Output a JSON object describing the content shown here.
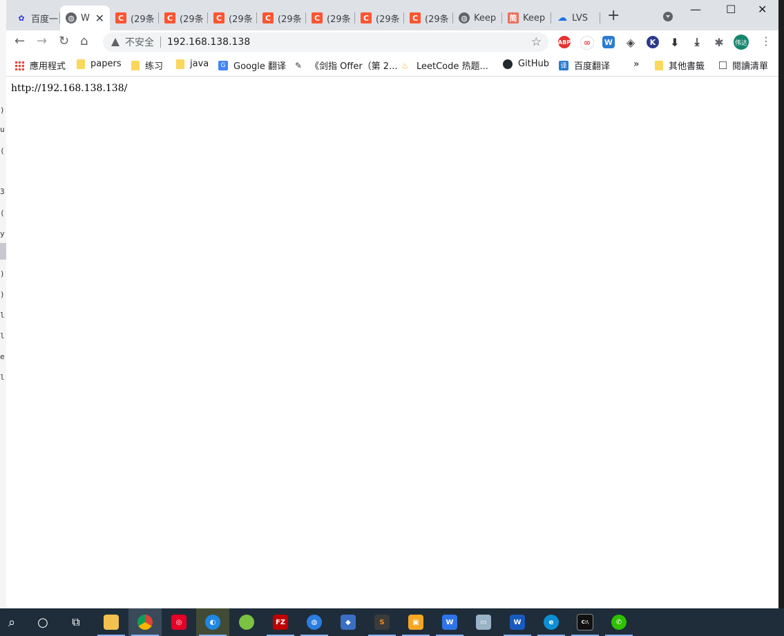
{
  "background_left": {
    "lines": [
      ")",
      "u",
      "(",
      "3",
      "(",
      "y",
      "-",
      ")",
      ")",
      "l",
      "l",
      "e",
      "l"
    ]
  },
  "tabs": [
    {
      "title": "百度一",
      "icon": "baidu-paw-icon",
      "color": "#2932e1"
    },
    {
      "title": "W",
      "icon": "globe-icon",
      "color": "#5f6368",
      "active": true
    },
    {
      "title": "(29条",
      "icon": "csdn-c-icon",
      "color": "#fc5531"
    },
    {
      "title": "(29条",
      "icon": "csdn-c-icon",
      "color": "#fc5531"
    },
    {
      "title": "(29条",
      "icon": "csdn-c-icon",
      "color": "#fc5531"
    },
    {
      "title": "(29条",
      "icon": "csdn-c-icon",
      "color": "#fc5531"
    },
    {
      "title": "(29条",
      "icon": "csdn-c-icon",
      "color": "#fc5531"
    },
    {
      "title": "(29条",
      "icon": "csdn-c-icon",
      "color": "#fc5531"
    },
    {
      "title": "(29条",
      "icon": "csdn-c-icon",
      "color": "#fc5531"
    },
    {
      "title": "Keep",
      "icon": "globe-icon",
      "color": "#5f6368"
    },
    {
      "title": "Keep",
      "icon": "jianshu-icon",
      "color": "#ea6f5a"
    },
    {
      "title": "LVS",
      "icon": "cloud-icon",
      "color": "#1a73e8"
    }
  ],
  "new_tab_label": "+",
  "window_controls": {
    "minimize": "—",
    "maximize": "☐",
    "close": "✕"
  },
  "toolbar": {
    "security_label": "不安全",
    "url": "192.168.138.138",
    "extensions": [
      {
        "name": "adblock-plus-icon",
        "label": "ABP",
        "color": "#e8312f"
      },
      {
        "name": "chain-extension-icon",
        "label": "∞",
        "color": "#e04c4c"
      },
      {
        "name": "word-extension-icon",
        "label": "W",
        "color": "#2b7cd3"
      },
      {
        "name": "shield-extension-icon",
        "label": "◈",
        "color": "#444444"
      },
      {
        "name": "k-extension-icon",
        "label": "K",
        "color": "#2d3a8c"
      },
      {
        "name": "download-extension-icon",
        "label": "⬇",
        "color": "#333333"
      },
      {
        "name": "downloads-icon",
        "label": "⤓",
        "color": "#333333"
      },
      {
        "name": "puzzle-extensions-icon",
        "label": "✱",
        "color": "#5f6368"
      }
    ],
    "avatar_text": "伟达"
  },
  "bookmarks": [
    {
      "label": "應用程式",
      "icon": "apps-grid-icon"
    },
    {
      "label": "papers",
      "icon": "folder-icon"
    },
    {
      "label": "练习",
      "icon": "folder-icon"
    },
    {
      "label": "java",
      "icon": "folder-icon"
    },
    {
      "label": "Google 翻译",
      "icon": "google-translate-icon"
    },
    {
      "label": "《剑指 Offer（第 2...",
      "icon": "quill-icon"
    },
    {
      "label": "LeetCode 热题...",
      "icon": "leetcode-fire-icon"
    },
    {
      "label": "GitHub",
      "icon": "github-icon"
    },
    {
      "label": "百度翻译",
      "icon": "baidu-translate-icon"
    }
  ],
  "bookmarks_overflow": "»",
  "other_bookmarks": "其他書籤",
  "reading_list": "閱讀清單",
  "page": {
    "text": "http://192.168.138.138/"
  },
  "taskbar": [
    {
      "name": "search-icon",
      "glyph": "⌕",
      "color": "transparent"
    },
    {
      "name": "cortana-icon",
      "glyph": "○",
      "color": "transparent"
    },
    {
      "name": "task-view-icon",
      "glyph": "⧉",
      "color": "transparent"
    },
    {
      "name": "file-explorer-icon",
      "glyph": "▬",
      "color": "#f2c14e"
    },
    {
      "name": "chrome-icon",
      "glyph": "◉",
      "color": "#db4437"
    },
    {
      "name": "netease-music-icon",
      "glyph": "◎",
      "color": "#e60026"
    },
    {
      "name": "blue-app-icon",
      "glyph": "◐",
      "color": "#1e88e5"
    },
    {
      "name": "green-app-icon",
      "glyph": "●",
      "color": "#7cc242"
    },
    {
      "name": "filezilla-icon",
      "glyph": "FZ",
      "color": "#bf0000"
    },
    {
      "name": "network-globe-icon",
      "glyph": "◍",
      "color": "#2a7de1"
    },
    {
      "name": "bird-app-icon",
      "glyph": "◆",
      "color": "#3a6fc4"
    },
    {
      "name": "sublime-text-icon",
      "glyph": "S",
      "color": "#f28b1e"
    },
    {
      "name": "vmware-icon",
      "glyph": "▣",
      "color": "#f5a623"
    },
    {
      "name": "wps-writer-icon",
      "glyph": "W",
      "color": "#2f74e8"
    },
    {
      "name": "remote-desktop-icon",
      "glyph": "▭",
      "color": "#9bb3c7"
    },
    {
      "name": "word-icon",
      "glyph": "W",
      "color": "#185abd"
    },
    {
      "name": "edge-icon",
      "glyph": "e",
      "color": "#0c8fd6"
    },
    {
      "name": "terminal-icon",
      "glyph": "C:\\",
      "color": "#111111"
    },
    {
      "name": "wechat-icon",
      "glyph": "✆",
      "color": "#2dc100"
    }
  ]
}
